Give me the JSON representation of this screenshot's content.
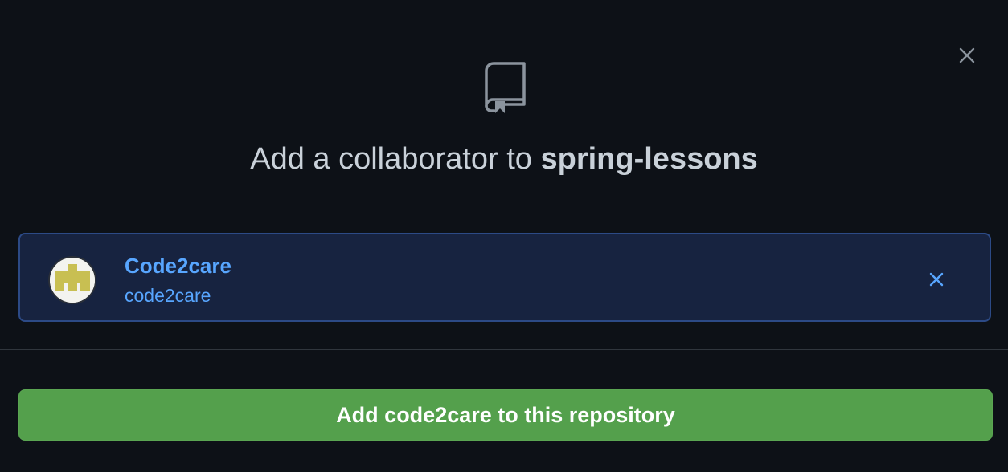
{
  "dialog": {
    "title_prefix": "Add a collaborator to ",
    "repo_name": "spring-lessons",
    "close_icon": "close-icon",
    "header_icon": "repo-icon"
  },
  "selected_user": {
    "display_name": "Code2care",
    "login": "code2care",
    "avatar_icon": "identicon-avatar",
    "remove_icon": "remove-icon"
  },
  "actions": {
    "add_button_label": "Add code2care to this repository"
  },
  "colors": {
    "background": "#0d1117",
    "card_background": "#172340",
    "card_border": "#2c4a86",
    "link": "#58a6ff",
    "primary_button": "#54a04c",
    "avatar_fill": "#c8bf52"
  }
}
